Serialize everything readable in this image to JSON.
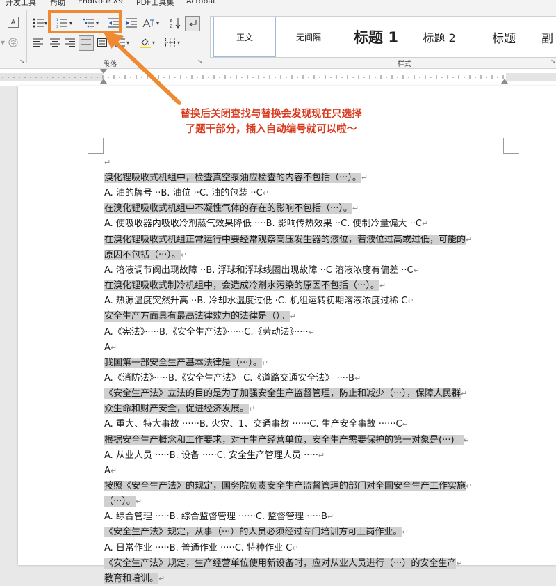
{
  "menu": {
    "items": [
      "开发工具",
      "帮助",
      "EndNote X9",
      "PDF工具集",
      "Acrobat"
    ]
  },
  "ribbon": {
    "paragraph_group_label": "段落",
    "styles_group_label": "样式",
    "styles": [
      "正文",
      "无间隔",
      "标题 1",
      "标题 2",
      "标题",
      "副"
    ],
    "icons": {
      "bullets": "bullet-list-icon",
      "numbering": "numbered-list-icon",
      "multilevel": "multilevel-list-icon",
      "decrease_indent": "decrease-indent-icon",
      "increase_indent": "increase-indent-icon",
      "chinese_layout": "chinese-layout-icon",
      "sort": "sort-icon",
      "show_marks": "pilcrow-icon",
      "align_left": "align-left-icon",
      "center": "align-center-icon",
      "align_right": "align-right-icon",
      "justify": "justify-icon",
      "distributed": "distributed-icon",
      "line_spacing": "line-spacing-icon",
      "shading": "shading-icon",
      "borders": "borders-icon"
    }
  },
  "annotation": {
    "line1": "替换后关闭查找与替换会发现现在只选择",
    "line2": "了题干部分，插入自动编号就可以啦～",
    "color": "#d93a1e",
    "box_color": "#f08a32"
  },
  "document": {
    "lines": [
      {
        "text": "溴化锂吸收式机组中，检查真空泵油应检查的内容不包括（···）。",
        "hl": true
      },
      {
        "text": "A. 油的牌号 ··B. 油位 ··C. 油的包装 ··C",
        "hl": false
      },
      {
        "text": "在溴化锂吸收式机组中不凝性气体的存在的影响不包括（···）。",
        "hl": true
      },
      {
        "text": "A. 使吸收器内吸收冷剂蒸气效果降低 ····B. 影响传热效果 ··C. 使制冷量偏大 ··C",
        "hl": false
      },
      {
        "text": "在溴化锂吸收式机组正常运行中要经常观察高压发生器的液位，若液位过高或过低，可能的",
        "hl": true
      },
      {
        "text": "原因不包括（···）。",
        "hl": true
      },
      {
        "text": "A. 溶液调节阀出现故障 ··B. 浮球和浮球线圈出现故障 ··C 溶液浓度有偏差 ··C",
        "hl": false
      },
      {
        "text": "在溴化锂吸收式制冷机组中，会造成冷剂水污染的原因不包括（···）。",
        "hl": true
      },
      {
        "text": "A. 热源温度突然升高 ··B. 冷却水温度过低 ·C. 机组运转初期溶液浓度过稀 C",
        "hl": false
      },
      {
        "text": "安全生产方面具有最高法律效力的法律是（）。",
        "hl": true
      },
      {
        "text": "A.《宪法》·····B.《安全生产法》······C.《劳动法》·····",
        "hl": false
      },
      {
        "text": "A",
        "hl": false
      },
      {
        "text": "我国第一部安全生产基本法律是（···）。",
        "hl": true
      },
      {
        "text": "A.《消防法》·····B.《安全生产法》 C.《道路交通安全法》 ····B",
        "hl": false
      },
      {
        "text": "《安全生产法》立法的目的是为了加强安全生产监督管理，防止和减少（···），保障人民群",
        "hl": true
      },
      {
        "text": "众生命和财产安全，促进经济发展。",
        "hl": true
      },
      {
        "text": "A. 重大、特大事故 ······B. 火灾、1、交通事故 ······C. 生产安全事故 ······C",
        "hl": false
      },
      {
        "text": "根据安全生产概念和工作要求，对于生产经营单位，安全生产需要保护的第一对象是(···)。",
        "hl": true
      },
      {
        "text": "A. 从业人员 ·····B. 设备 ·····C. 安全生产管理人员 ·····",
        "hl": false
      },
      {
        "text": "A",
        "hl": false
      },
      {
        "text": "按照《安全生产法》的规定，国务院负责安全生产监督管理的部门对全国安全生产工作实施",
        "hl": true
      },
      {
        "text": "（···）。",
        "hl": true
      },
      {
        "text": "A. 综合管理 ·····B. 综合监督管理 ······C. 监督管理 ·····B",
        "hl": false
      },
      {
        "text": "《安全生产法》规定，从事（···）的人员必须经过专门培训方可上岗作业。",
        "hl": true
      },
      {
        "text": "A. 日常作业 ·····B. 普通作业 ·····C. 特种作业 C",
        "hl": false
      },
      {
        "text": "《安全生产法》规定，生产经营单位使用新设备时，应对从业人员进行（···）的安全生产",
        "hl": true
      },
      {
        "text": "教育和培训。",
        "hl": true
      }
    ],
    "para_mark": "↵",
    "top_mark": "↵"
  }
}
